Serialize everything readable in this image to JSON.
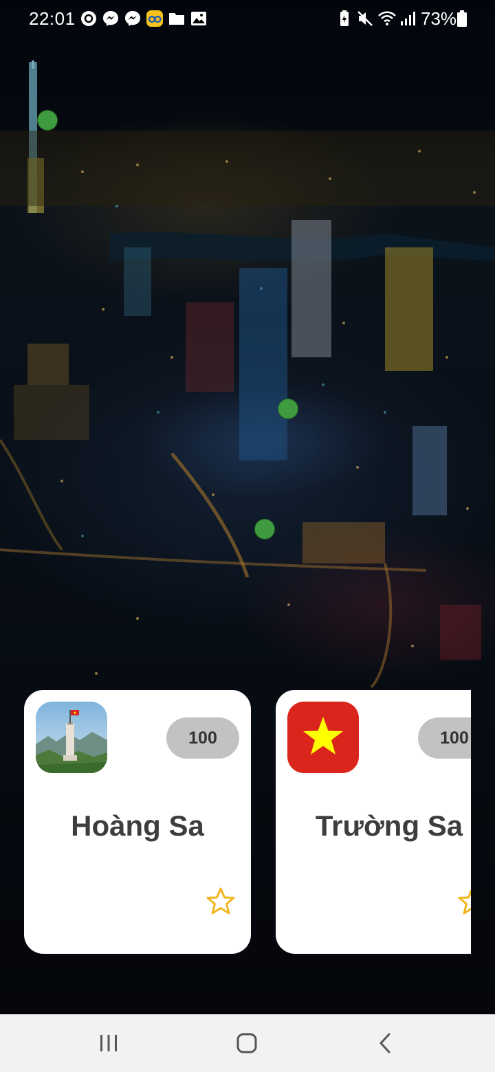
{
  "status_bar": {
    "time": "22:01",
    "battery_percent": "73%",
    "notification_icons": [
      "threads-icon",
      "messenger-icon",
      "messenger-icon",
      "be-app-icon",
      "folder-icon",
      "gallery-icon"
    ],
    "system_icons": [
      "battery-saver-icon",
      "mute-icon",
      "wifi-icon",
      "signal-icon",
      "battery-icon"
    ]
  },
  "map": {
    "marker_color": "#3f9b3f",
    "marker_count": 3
  },
  "cards": [
    {
      "title": "Hoàng Sa",
      "count": "100",
      "thumbnail": "flag-tower-photo",
      "favorite_icon": "star-outline-icon"
    },
    {
      "title": "Trường Sa",
      "count": "100",
      "thumbnail": "vietnam-flag-icon",
      "favorite_icon": "star-outline-icon"
    }
  ],
  "colors": {
    "star": "#f2b51d",
    "count_pill": "#c2c2c2",
    "flag_red": "#da251d",
    "flag_star": "#ffff00"
  },
  "nav_bar": {
    "buttons": [
      "recent-apps-icon",
      "home-icon",
      "back-icon"
    ]
  }
}
